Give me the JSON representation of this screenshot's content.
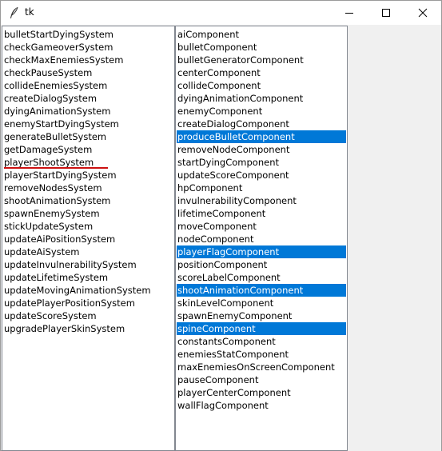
{
  "window": {
    "title": "tk",
    "controls": {
      "icon": "feather-icon",
      "minimize": "minimize-icon",
      "maximize": "maximize-icon",
      "close": "close-icon"
    }
  },
  "colors": {
    "selection": "#0078d7",
    "underline": "#cc1111"
  },
  "systems": {
    "active_item": "playerShootSystem",
    "items": [
      "bulletStartDyingSystem",
      "checkGameoverSystem",
      "checkMaxEnemiesSystem",
      "checkPauseSystem",
      "collideEnemiesSystem",
      "createDialogSystem",
      "dyingAnimationSystem",
      "enemyStartDyingSystem",
      "generateBulletSystem",
      "getDamageSystem",
      "playerShootSystem",
      "playerStartDyingSystem",
      "removeNodesSystem",
      "shootAnimationSystem",
      "spawnEnemySystem",
      "stickUpdateSystem",
      "updateAiPositionSystem",
      "updateAiSystem",
      "updateInvulnerabilitySystem",
      "updateLifetimeSystem",
      "updateMovingAnimationSystem",
      "updatePlayerPositionSystem",
      "updateScoreSystem",
      "upgradePlayerSkinSystem"
    ]
  },
  "components": {
    "selected": [
      "produceBulletComponent",
      "playerFlagComponent",
      "shootAnimationComponent",
      "spineComponent"
    ],
    "items": [
      "aiComponent",
      "bulletComponent",
      "bulletGeneratorComponent",
      "centerComponent",
      "collideComponent",
      "dyingAnimationComponent",
      "enemyComponent",
      "createDialogComponent",
      "produceBulletComponent",
      "removeNodeComponent",
      "startDyingComponent",
      "updateScoreComponent",
      "hpComponent",
      "invulnerabilityComponent",
      "lifetimeComponent",
      "moveComponent",
      "nodeComponent",
      "playerFlagComponent",
      "positionComponent",
      "scoreLabelComponent",
      "shootAnimationComponent",
      "skinLevelComponent",
      "spawnEnemyComponent",
      "spineComponent",
      "constantsComponent",
      "enemiesStatComponent",
      "maxEnemiesOnScreenComponent",
      "pauseComponent",
      "playerCenterComponent",
      "wallFlagComponent"
    ]
  }
}
